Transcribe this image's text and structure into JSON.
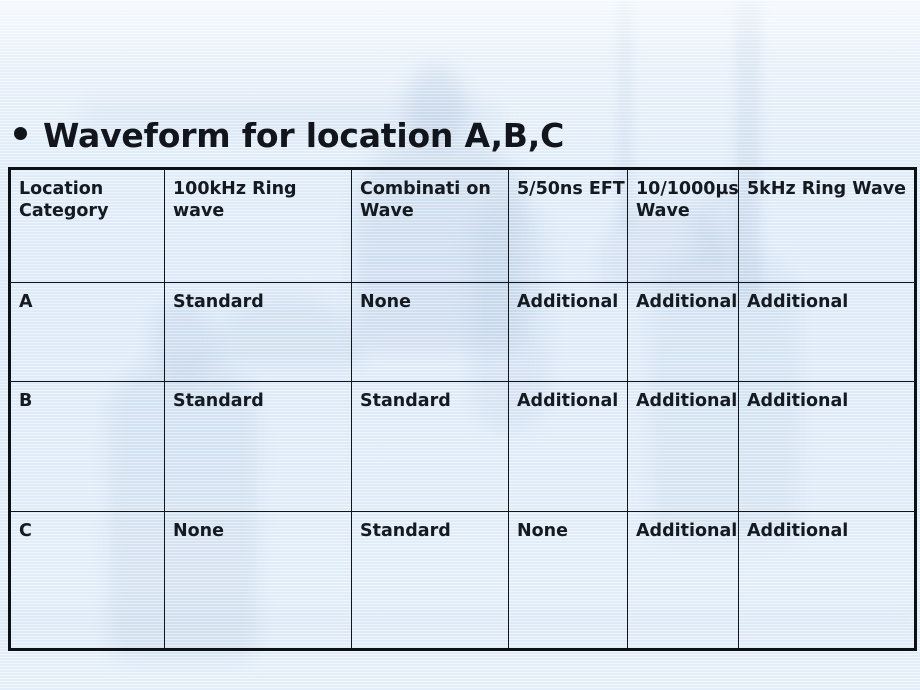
{
  "slide": {
    "title": "Waveform for location A,B,C",
    "bullet_glyph": "•",
    "background_color": "#e3eefa",
    "text_color": "#141a20",
    "border_color": "#10151b"
  },
  "table": {
    "headers": [
      "Location Category",
      "100kHz Ring wave",
      "Combinati on Wave",
      "5/50ns EFT",
      "10/1000µs Wave",
      "5kHz Ring Wave"
    ],
    "rows": [
      {
        "category": "A",
        "category_align": "top",
        "cells": [
          "Standard",
          "None",
          "Additional",
          "Additional",
          "Additional"
        ]
      },
      {
        "category": "B",
        "category_align": "middle",
        "cells": [
          "Standard",
          "Standard",
          "Additional",
          "Additional",
          "Additional"
        ]
      },
      {
        "category": "C",
        "category_align": "middle",
        "cells": [
          "None",
          "Standard",
          "None",
          "Additional",
          "Additional"
        ]
      }
    ]
  }
}
